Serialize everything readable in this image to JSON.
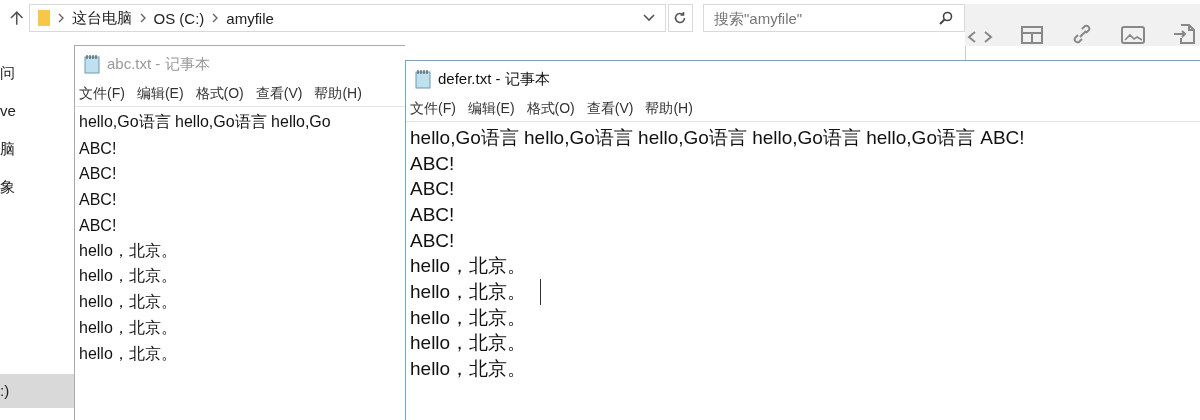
{
  "explorer": {
    "breadcrumbs": [
      "这台电脑",
      "OS (C:)",
      "amyfile"
    ],
    "search": {
      "placeholder": "搜索\"amyfile\""
    },
    "nav_items": [
      {
        "label": "问",
        "selected": false
      },
      {
        "label": "ve",
        "selected": false
      },
      {
        "label": "脑",
        "selected": false
      },
      {
        "label": "象",
        "selected": false
      },
      {
        "label": ":)",
        "selected": true
      }
    ]
  },
  "notepads": [
    {
      "title": "abc.txt - 记事本",
      "active": false,
      "menu": [
        "文件(F)",
        "编辑(E)",
        "格式(O)",
        "查看(V)",
        "帮助(H)"
      ],
      "lines": [
        {
          "text": "hello,Go语言 hello,Go语言 hello,Go",
          "caret": false
        },
        {
          "text": "ABC!",
          "caret": false
        },
        {
          "text": "ABC!",
          "caret": false
        },
        {
          "text": "ABC!",
          "caret": false
        },
        {
          "text": "ABC!",
          "caret": false
        },
        {
          "text": "hello，北京。",
          "caret": false
        },
        {
          "text": "hello，北京。",
          "caret": false
        },
        {
          "text": "hello，北京。",
          "caret": false
        },
        {
          "text": "hello，北京。",
          "caret": false
        },
        {
          "text": "hello，北京。",
          "caret": false
        }
      ]
    },
    {
      "title": "defer.txt - 记事本",
      "active": true,
      "menu": [
        "文件(F)",
        "编辑(E)",
        "格式(O)",
        "查看(V)",
        "帮助(H)"
      ],
      "lines": [
        {
          "text": "hello,Go语言 hello,Go语言 hello,Go语言 hello,Go语言 hello,Go语言 ABC!",
          "caret": false
        },
        {
          "text": "ABC!",
          "caret": false
        },
        {
          "text": "ABC!",
          "caret": false
        },
        {
          "text": "ABC!",
          "caret": false
        },
        {
          "text": "ABC!",
          "caret": false
        },
        {
          "text": "hello，北京。",
          "caret": false
        },
        {
          "text": "hello，北京。",
          "caret": true
        },
        {
          "text": "hello，北京。",
          "caret": false
        },
        {
          "text": "hello，北京。",
          "caret": false
        },
        {
          "text": "hello，北京。",
          "caret": false
        }
      ]
    }
  ]
}
